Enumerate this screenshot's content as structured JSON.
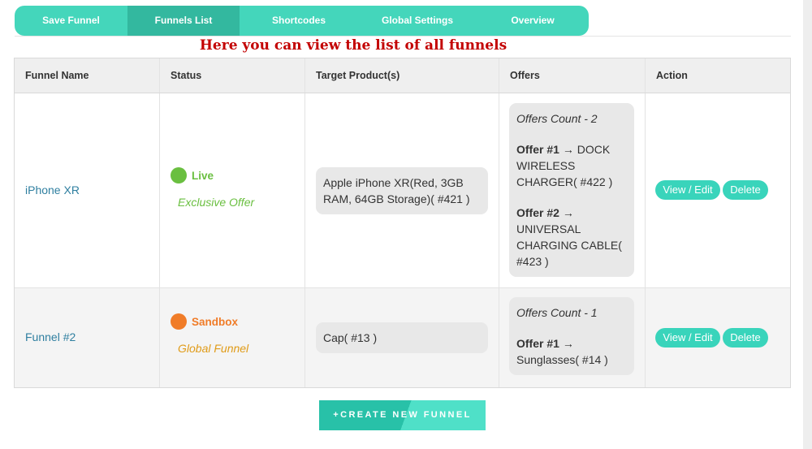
{
  "tabs": [
    {
      "label": "Save Funnel",
      "active": false
    },
    {
      "label": "Funnels List",
      "active": true
    },
    {
      "label": "Shortcodes",
      "active": false
    },
    {
      "label": "Global Settings",
      "active": false
    },
    {
      "label": "Overview",
      "active": false
    }
  ],
  "heading": "Here you can view the list of all funnels",
  "table": {
    "headers": [
      "Funnel Name",
      "Status",
      "Target Product(s)",
      "Offers",
      "Action"
    ],
    "rows": [
      {
        "name": "iPhone XR",
        "status": "Live",
        "status_color": "#6abf40",
        "status_sub": "Exclusive Offer",
        "product": "Apple iPhone XR(Red, 3GB RAM, 64GB Storage)( #421 )",
        "offers_count": "Offers Count - 2",
        "offers": [
          {
            "label": "Offer #1",
            "arrow": "→",
            "text": "DOCK WIRELESS CHARGER( #422 )"
          },
          {
            "label": "Offer #2",
            "arrow": "→",
            "text": "UNIVERSAL CHARGING CABLE( #423 )"
          }
        ],
        "edit_label": "View / Edit",
        "delete_label": "Delete"
      },
      {
        "name": "Funnel #2",
        "status": "Sandbox",
        "status_color": "#f07c28",
        "status_sub": "Global Funnel",
        "sub_color": "#e09b18",
        "product": "Cap( #13 )",
        "offers_count": "Offers Count - 1",
        "offers": [
          {
            "label": "Offer #1",
            "arrow": "→",
            "text": "Sunglasses( #14 )"
          }
        ],
        "edit_label": "View / Edit",
        "delete_label": "Delete"
      }
    ]
  },
  "create_button": "+CREATE NEW FUNNEL",
  "colors": {
    "accent": "#44d6bb",
    "accent_dark": "#33b89f",
    "heading": "#c30000",
    "link": "#2f7fa0"
  }
}
